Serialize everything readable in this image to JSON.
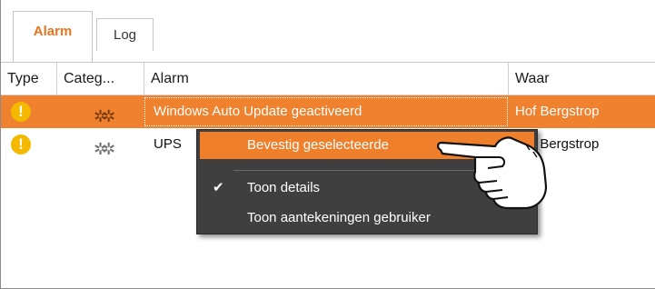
{
  "tabs": [
    {
      "label": "Alarm",
      "active": true
    },
    {
      "label": "Log",
      "active": false
    }
  ],
  "columns": [
    "Type",
    "Categ...",
    "Alarm",
    "Waar"
  ],
  "rows": [
    {
      "type_icon": "warning-icon",
      "category_icon": "gears-icon",
      "alarm": "Windows Auto Update geactiveerd",
      "waar": "Hof Bergstrop",
      "selected": true
    },
    {
      "type_icon": "warning-icon",
      "category_icon": "gears-icon",
      "alarm": "UPS",
      "waar": "f Bergstrop",
      "selected": false
    }
  ],
  "context_menu": {
    "items": [
      {
        "label": "Bevestig geselecteerde",
        "highlighted": true,
        "checked": false
      },
      {
        "label": "Toon details",
        "highlighted": false,
        "checked": true
      },
      {
        "label": "Toon aantekeningen gebruiker",
        "highlighted": false,
        "checked": false
      }
    ]
  },
  "colors": {
    "accent": "#e8761e",
    "selected_row": "#f0812e",
    "menu_bg": "#3f3f3f",
    "menu_highlight": "#ef7f2a",
    "warning": "#f5b800"
  },
  "icons": {
    "warning": "!",
    "gears": "✲✲",
    "check": "✔",
    "pointer": "hand-pointer-icon"
  }
}
